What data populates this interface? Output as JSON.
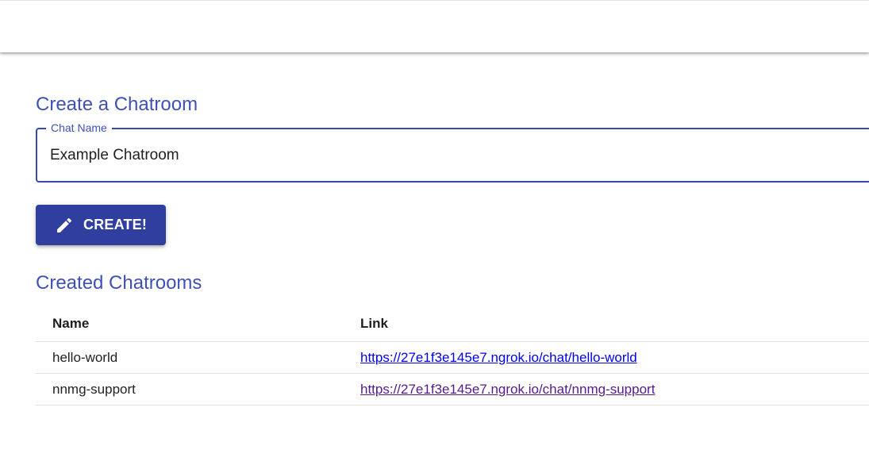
{
  "create_section": {
    "heading": "Create a Chatroom",
    "chat_name_label": "Chat Name",
    "chat_name_value": "Example Chatroom",
    "create_button_label": "CREATE!",
    "create_button_icon": "pencil-icon"
  },
  "rooms_section": {
    "heading": "Created Chatrooms",
    "columns": {
      "name": "Name",
      "link": "Link"
    },
    "rows": [
      {
        "name": "hello-world",
        "link": "https://27e1f3e145e7.ngrok.io/chat/hello-world",
        "visited": false
      },
      {
        "name": "nnmg-support",
        "link": "https://27e1f3e145e7.ngrok.io/chat/nnmg-support",
        "visited": true
      }
    ]
  },
  "colors": {
    "accent": "#3f51b5",
    "button": "#303f9f",
    "link": "#0000ee",
    "link_visited": "#551a8b"
  }
}
